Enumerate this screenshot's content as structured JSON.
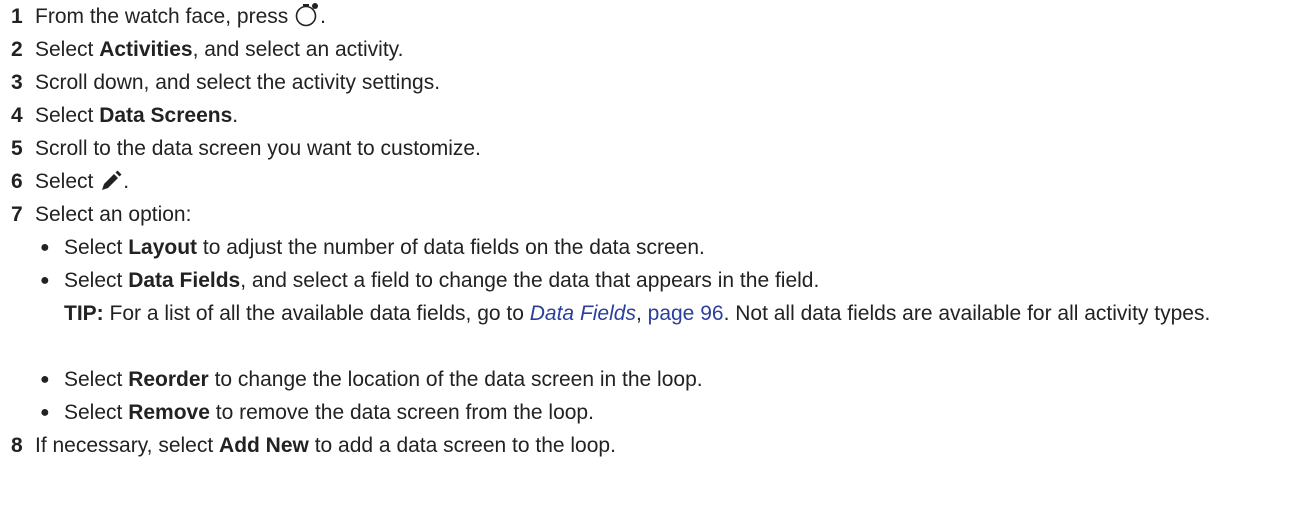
{
  "steps": [
    {
      "num": "1",
      "before": "From the watch face, press ",
      "icon": "watch-button-icon",
      "after": "."
    },
    {
      "num": "2",
      "before": "Select ",
      "bold": "Activities",
      "after": ", and select an activity."
    },
    {
      "num": "3",
      "text": "Scroll down, and select the activity settings."
    },
    {
      "num": "4",
      "before": "Select ",
      "bold": "Data Screens",
      "after": "."
    },
    {
      "num": "5",
      "text": "Scroll to the data screen you want to customize."
    },
    {
      "num": "6",
      "before": "Select ",
      "icon": "pencil-icon",
      "after": "."
    },
    {
      "num": "7",
      "text": "Select an option:"
    },
    {
      "num": "8",
      "before": "If necessary, select ",
      "bold": "Add New",
      "after": " to add a data screen to the loop."
    }
  ],
  "options": [
    {
      "bullet": "●",
      "before": "Select ",
      "bold": "Layout",
      "after": " to adjust the number of data fields on the data screen."
    },
    {
      "bullet": "●",
      "before": "Select ",
      "bold": "Data Fields",
      "after": ", and select a field to change the data that appears in the field."
    },
    {
      "bullet": "●",
      "before": "Select ",
      "bold": "Reorder",
      "after": " to change the location of the data screen in the loop."
    },
    {
      "bullet": "●",
      "before": "Select ",
      "bold": "Remove",
      "after": " to remove the data screen from the loop."
    }
  ],
  "tip": {
    "label": "TIP:",
    "before": " For a list of all the available data fields, go to ",
    "link_title": "Data Fields",
    "comma": ", ",
    "link_page": "page 96",
    "after": ". Not all data fields are available for all activity types."
  }
}
